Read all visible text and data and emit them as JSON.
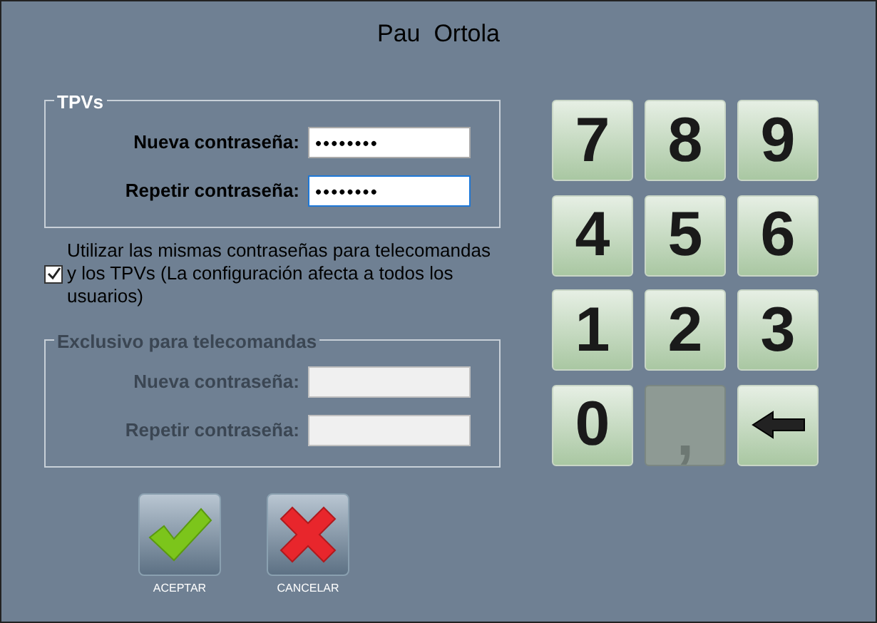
{
  "window": {
    "title": "Pau  Ortola"
  },
  "tpvs_group": {
    "title": "TPVs",
    "disabled": false,
    "fields": [
      {
        "label": "Nueva contraseña:",
        "value": "••••••••",
        "focused": false
      },
      {
        "label": "Repetir contraseña:",
        "value": "••••••••",
        "focused": true
      }
    ]
  },
  "same_passwords": {
    "label": "Utilizar las mismas contraseñas para telecomandas y los TPVs (La configuración afecta a todos los usuarios)",
    "checked": true
  },
  "telecomandas_group": {
    "title": "Exclusivo para telecomandas",
    "disabled": true,
    "fields": [
      {
        "label": "Nueva contraseña:",
        "focused": false
      },
      {
        "label": "Repetir contraseña:",
        "focused": false
      }
    ]
  },
  "keypad": [
    {
      "kind": "digit",
      "label": "7",
      "disabled": false
    },
    {
      "kind": "digit",
      "label": "8",
      "disabled": false
    },
    {
      "kind": "digit",
      "label": "9",
      "disabled": false
    },
    {
      "kind": "digit",
      "label": "4",
      "disabled": false
    },
    {
      "kind": "digit",
      "label": "5",
      "disabled": false
    },
    {
      "kind": "digit",
      "label": "6",
      "disabled": false
    },
    {
      "kind": "digit",
      "label": "1",
      "disabled": false
    },
    {
      "kind": "digit",
      "label": "2",
      "disabled": false
    },
    {
      "kind": "digit",
      "label": "3",
      "disabled": false
    },
    {
      "kind": "digit",
      "label": "0",
      "disabled": false
    },
    {
      "kind": "digit",
      "label": ",",
      "disabled": true
    },
    {
      "kind": "backspace",
      "disabled": false
    }
  ],
  "actions": [
    {
      "kind": "accept",
      "label": "ACEPTAR"
    },
    {
      "kind": "cancel",
      "label": "CANCELAR"
    }
  ]
}
